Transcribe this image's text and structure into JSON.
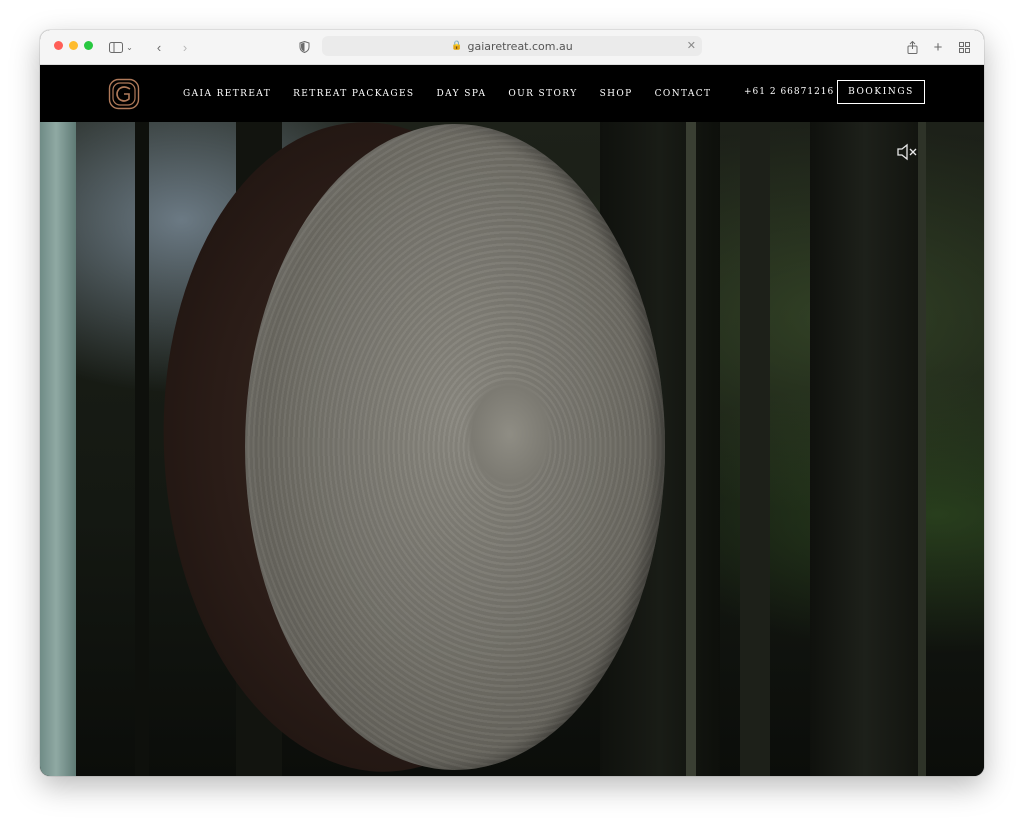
{
  "browser": {
    "url": "gaiaretreat.com.au"
  },
  "site": {
    "nav": [
      {
        "label": "GAIA RETREAT"
      },
      {
        "label": "RETREAT PACKAGES"
      },
      {
        "label": "DAY SPA"
      },
      {
        "label": "OUR STORY"
      },
      {
        "label": "SHOP"
      },
      {
        "label": "CONTACT"
      }
    ],
    "phone": "+61 2 66871216",
    "booking_label": "BOOKINGS"
  },
  "hero": {
    "image": "gong-icon",
    "sound_toggle": "speaker-muted-icon"
  },
  "colors": {
    "header_bg": "#000000",
    "logo_accent": "#b07a5a",
    "traffic_red": "#ff5f57",
    "traffic_yellow": "#febc2e",
    "traffic_green": "#28c840"
  }
}
